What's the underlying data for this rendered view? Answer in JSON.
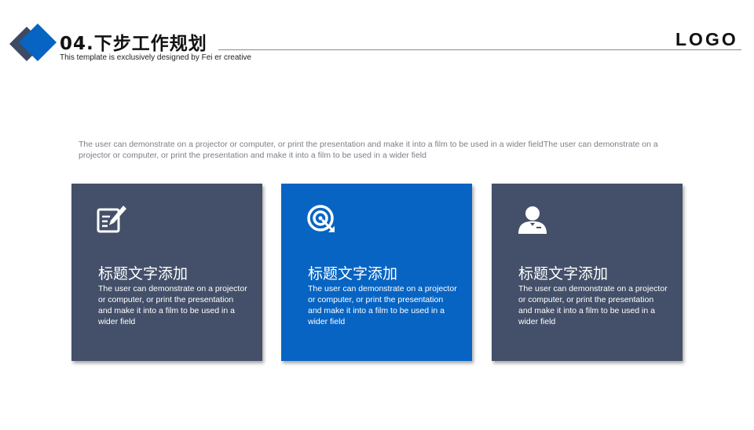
{
  "header": {
    "title": "04.下步工作规划",
    "subtitle": "This template is exclusively designed by Fei er creative",
    "logo": "LOGO"
  },
  "intro": "The user can demonstrate on a projector or computer, or print the presentation and make it into a film to be used in a wider fieldThe user can demonstrate on a projector or computer, or print the presentation and make it into a film to be used in a wider field",
  "cards": [
    {
      "icon": "edit-document-icon",
      "title": "标题文字添加",
      "body": "The user can demonstrate on a projector or computer, or print the presentation and make it into a film to be used in a wider field",
      "color": "#445069"
    },
    {
      "icon": "target-icon",
      "title": "标题文字添加",
      "body": "The user can demonstrate on a projector or computer, or print the presentation and make it into a film to be used in a wider field",
      "color": "#0764c3"
    },
    {
      "icon": "user-icon",
      "title": "标题文字添加",
      "body": "The user can demonstrate on a projector or computer, or print the presentation and make it into a film to be used in a wider field",
      "color": "#445069"
    }
  ],
  "colors": {
    "accent": "#0764c3",
    "card_dark": "#445069"
  }
}
